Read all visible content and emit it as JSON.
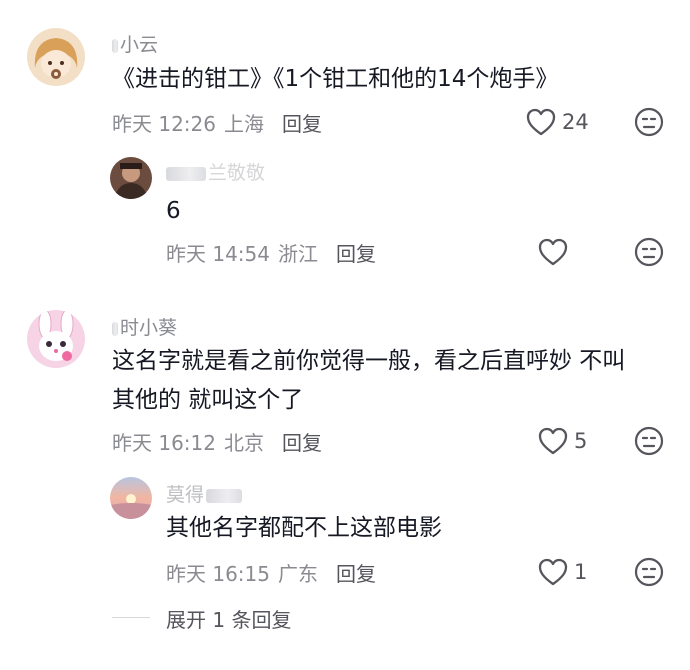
{
  "comments": [
    {
      "name": "小云",
      "text": [
        "《进击的钳工》《1个钳工和他的14个炮手》"
      ],
      "time": "昨天 12:26",
      "location": "上海",
      "reply_label": "回复",
      "likes": "24"
    },
    {
      "name": "兰敬敬",
      "text": [
        "6"
      ],
      "time": "昨天 14:54",
      "location": "浙江",
      "reply_label": "回复",
      "likes": ""
    },
    {
      "name": "时小葵",
      "text": [
        "这名字就是看之前你觉得一般，看之后直呼妙 不叫",
        "其他的 就叫这个了"
      ],
      "time": "昨天 16:12",
      "location": "北京",
      "reply_label": "回复",
      "likes": "5"
    },
    {
      "name": "莫得",
      "text": [
        "其他名字都配不上这部电影"
      ],
      "time": "昨天 16:15",
      "location": "广东",
      "reply_label": "回复",
      "likes": "1"
    }
  ],
  "expand_replies_label": "展开 1 条回复",
  "icons": [
    "heart-outline-icon",
    "dislike-face-icon"
  ],
  "colors": {
    "text": "#161823",
    "meta": "#8a8b91",
    "icon": "#55565c"
  }
}
